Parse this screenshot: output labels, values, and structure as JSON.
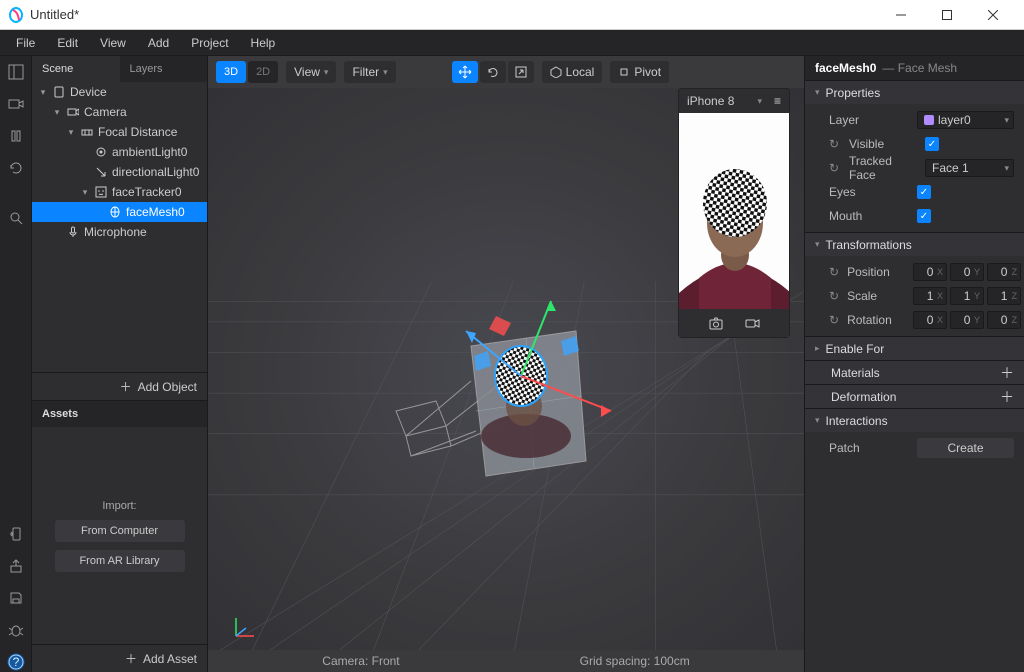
{
  "window": {
    "title": "Untitled*"
  },
  "menu": [
    "File",
    "Edit",
    "View",
    "Add",
    "Project",
    "Help"
  ],
  "left_tabs": {
    "scene": "Scene",
    "layers": "Layers"
  },
  "scene_tree": [
    {
      "indent": 0,
      "icon": "device",
      "label": "Device",
      "toggle": "▾"
    },
    {
      "indent": 1,
      "icon": "camera",
      "label": "Camera",
      "toggle": "▾"
    },
    {
      "indent": 2,
      "icon": "focal",
      "label": "Focal Distance",
      "toggle": "▾"
    },
    {
      "indent": 3,
      "icon": "ambient",
      "label": "ambientLight0",
      "toggle": ""
    },
    {
      "indent": 3,
      "icon": "directional",
      "label": "directionalLight0",
      "toggle": ""
    },
    {
      "indent": 3,
      "icon": "tracker",
      "label": "faceTracker0",
      "toggle": "▾"
    },
    {
      "indent": 4,
      "icon": "facemesh",
      "label": "faceMesh0",
      "toggle": "",
      "selected": true
    },
    {
      "indent": 1,
      "icon": "mic",
      "label": "Microphone",
      "toggle": ""
    }
  ],
  "add_object": "Add Object",
  "assets": {
    "title": "Assets",
    "import_label": "Import:",
    "from_computer": "From Computer",
    "from_library": "From AR Library",
    "add_asset": "Add Asset"
  },
  "viewport": {
    "mode3d": "3D",
    "mode2d": "2D",
    "view": "View",
    "filter": "Filter",
    "local": "Local",
    "pivot": "Pivot",
    "camera_label": "Camera: Front",
    "grid_label": "Grid spacing: 100cm"
  },
  "device_preview": {
    "name": "iPhone 8"
  },
  "inspector": {
    "name": "faceMesh0",
    "type": "— Face Mesh",
    "sections": {
      "properties": "Properties",
      "transformations": "Transformations",
      "enable_for": "Enable For",
      "materials": "Materials",
      "deformation": "Deformation",
      "interactions": "Interactions"
    },
    "props": {
      "layer_label": "Layer",
      "layer_value": "layer0",
      "visible_label": "Visible",
      "tracked_label": "Tracked Face",
      "tracked_value": "Face 1",
      "eyes_label": "Eyes",
      "mouth_label": "Mouth"
    },
    "transforms": {
      "position": {
        "label": "Position",
        "x": "0",
        "y": "0",
        "z": "0"
      },
      "scale": {
        "label": "Scale",
        "x": "1",
        "y": "1",
        "z": "1"
      },
      "rotation": {
        "label": "Rotation",
        "x": "0",
        "y": "0",
        "z": "0"
      }
    },
    "patch_label": "Patch",
    "create_label": "Create"
  }
}
